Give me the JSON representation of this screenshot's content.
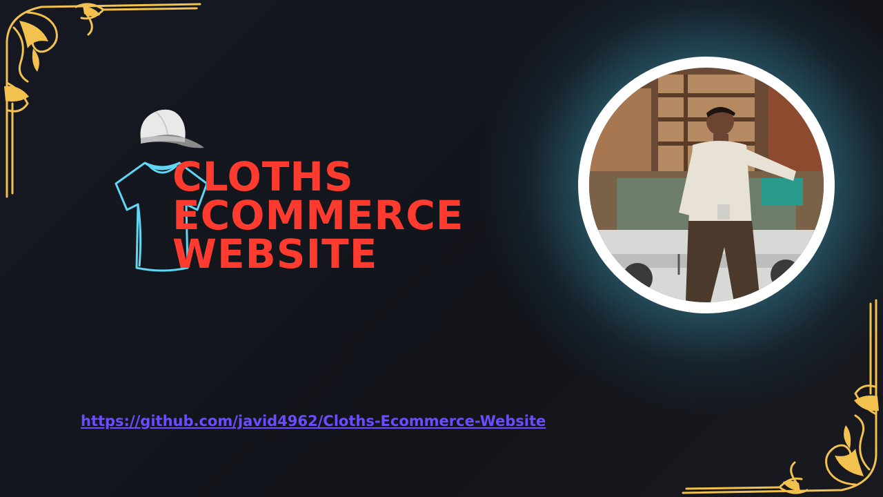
{
  "title_lines": [
    "CLOTHS",
    "ECOMMERCE",
    "WEBSITE"
  ],
  "link": {
    "text": "https://github.com/javid4962/Cloths-Ecommerce-Website",
    "href": "https://github.com/javid4962/Cloths-Ecommerce-Website"
  },
  "colors": {
    "background": "#15171e",
    "title": "#ff3b30",
    "link": "#6b4cff",
    "glow": "#5ac8dc",
    "ornament": "#f2c14e",
    "shirt_outline": "#5fd6f2"
  },
  "icons": {
    "cap": "baseball-cap-icon",
    "shirt": "t-shirt-icon",
    "ornament": "gold-corner-ornament"
  }
}
